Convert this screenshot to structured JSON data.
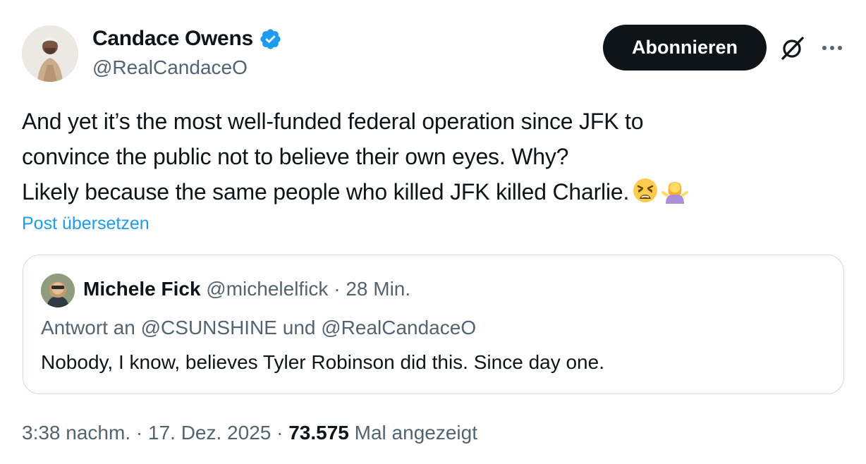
{
  "author": {
    "display_name": "Candace Owens",
    "handle": "@RealCandaceO",
    "verified": true
  },
  "actions": {
    "follow_label": "Abonnieren",
    "grok_icon": "grok-icon",
    "more_icon": "more-icon"
  },
  "tweet": {
    "lines": [
      "And yet it’s the most well-funded federal operation since JFK to",
      "convince the public not to believe their own eyes. Why?",
      "Likely because the same people who killed JFK killed Charlie."
    ],
    "emojis": [
      "weary-face",
      "woman-shrugging"
    ],
    "translate_label": "Post übersetzen"
  },
  "quote": {
    "display_name": "Michele Fick",
    "handle": "@michelelfick",
    "separator": "·",
    "time": "28 Min.",
    "reply_to": "Antwort an @CSUNSHINE und @RealCandaceO",
    "text": "Nobody, I know, believes Tyler Robinson did this. Since day one."
  },
  "footer": {
    "time": "3:38 nachm.",
    "separator": "·",
    "date": "17. Dez. 2025",
    "views_count": "73.575",
    "views_label": "Mal angezeigt"
  },
  "colors": {
    "text": "#0f1419",
    "secondary": "#536471",
    "link": "#1d9bf0",
    "verified": "#1d9bf0",
    "button_bg": "#0f1419",
    "border": "#cfd9de"
  }
}
